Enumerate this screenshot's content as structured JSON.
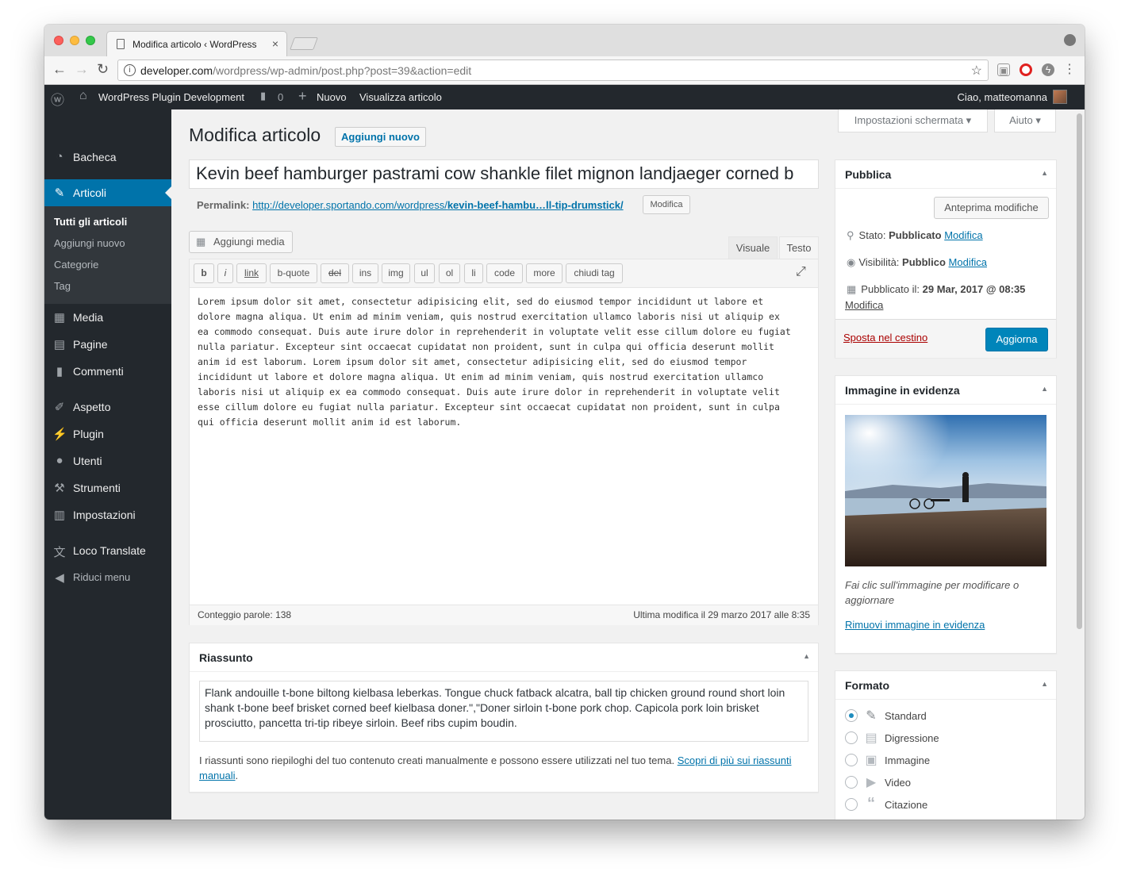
{
  "browser": {
    "tab_title": "Modifica articolo ‹ WordPress",
    "tab_close": "×",
    "url_host": "developer.com",
    "url_path": "/wordpress/wp-admin/post.php?post=39&action=edit"
  },
  "adminbar": {
    "site_name": "WordPress Plugin Development",
    "comments_count": "0",
    "new_label": "Nuovo",
    "view_post": "Visualizza articolo",
    "greeting": "Ciao, matteomanna"
  },
  "sidebar": {
    "items": [
      {
        "label": "Bacheca",
        "icon": "dashboard-icon"
      },
      {
        "label": "Articoli",
        "icon": "pin-icon"
      },
      {
        "label": "Media",
        "icon": "media-icon"
      },
      {
        "label": "Pagine",
        "icon": "page-icon"
      },
      {
        "label": "Commenti",
        "icon": "comment-icon"
      },
      {
        "label": "Aspetto",
        "icon": "brush-icon"
      },
      {
        "label": "Plugin",
        "icon": "plugin-icon"
      },
      {
        "label": "Utenti",
        "icon": "user-icon"
      },
      {
        "label": "Strumenti",
        "icon": "wrench-icon"
      },
      {
        "label": "Impostazioni",
        "icon": "settings-icon"
      },
      {
        "label": "Loco Translate",
        "icon": "translate-icon"
      },
      {
        "label": "Riduci menu",
        "icon": "collapse-icon"
      }
    ],
    "submenu": [
      "Tutti gli articoli",
      "Aggiungi nuovo",
      "Categorie",
      "Tag"
    ]
  },
  "header": {
    "title": "Modifica articolo",
    "add_new": "Aggiungi nuovo",
    "screen_options": "Impostazioni schermata",
    "help": "Aiuto"
  },
  "post": {
    "title": "Kevin beef hamburger pastrami cow shankle filet mignon landjaeger corned b",
    "permalink_label": "Permalink:",
    "permalink_base": "http://developer.sportando.com/wordpress/",
    "permalink_slug": "kevin-beef-hambu…ll-tip-drumstick/",
    "permalink_edit": "Modifica"
  },
  "editor": {
    "add_media": "Aggiungi media",
    "tab_visual": "Visuale",
    "tab_text": "Testo",
    "quicktags": [
      "b",
      "i",
      "link",
      "b-quote",
      "del",
      "ins",
      "img",
      "ul",
      "ol",
      "li",
      "code",
      "more",
      "chiudi tag"
    ],
    "content": "Lorem ipsum dolor sit amet, consectetur adipisicing elit, sed do eiusmod tempor incididunt ut labore et\ndolore magna aliqua. Ut enim ad minim veniam, quis nostrud exercitation ullamco laboris nisi ut aliquip ex\nea commodo consequat. Duis aute irure dolor in reprehenderit in voluptate velit esse cillum dolore eu fugiat\nnulla pariatur. Excepteur sint occaecat cupidatat non proident, sunt in culpa qui officia deserunt mollit\nanim id est laborum. Lorem ipsum dolor sit amet, consectetur adipisicing elit, sed do eiusmod tempor\nincididunt ut labore et dolore magna aliqua. Ut enim ad minim veniam, quis nostrud exercitation ullamco\nlaboris nisi ut aliquip ex ea commodo consequat. Duis aute irure dolor in reprehenderit in voluptate velit\nesse cillum dolore eu fugiat nulla pariatur. Excepteur sint occaecat cupidatat non proident, sunt in culpa\nqui officia deserunt mollit anim id est laborum.",
    "word_count": "Conteggio parole: 138",
    "last_edit": "Ultima modifica il 29 marzo 2017 alle 8:35"
  },
  "excerpt": {
    "title": "Riassunto",
    "text": "Flank andouille t-bone biltong kielbasa leberkas. Tongue chuck fatback alcatra, ball tip chicken ground round short loin shank t-bone beef brisket corned beef kielbasa doner.\",\"Doner sirloin t-bone pork chop. Capicola pork loin brisket prosciutto, pancetta tri-tip ribeye sirloin. Beef ribs cupim boudin.",
    "help": "I riassunti sono riepiloghi del tuo contenuto creati manualmente e possono essere utilizzati nel tuo tema.",
    "help_link": "Scopri di più sui riassunti manuali",
    "help_end": "."
  },
  "publish": {
    "title": "Pubblica",
    "preview": "Anteprima modifiche",
    "status_label": "Stato:",
    "status_value": "Pubblicato",
    "visibility_label": "Visibilità:",
    "visibility_value": "Pubblico",
    "date_label": "Pubblicato il:",
    "date_value": "29 Mar, 2017 @ 08:35",
    "edit": "Modifica",
    "trash": "Sposta nel cestino",
    "update": "Aggiorna"
  },
  "featured": {
    "title": "Immagine in evidenza",
    "hint": "Fai clic sull'immagine per modificare o aggiornare",
    "remove": "Rimuovi immagine in evidenza"
  },
  "format": {
    "title": "Formato",
    "options": [
      "Standard",
      "Digressione",
      "Immagine",
      "Video",
      "Citazione"
    ],
    "selected": "Standard"
  },
  "colors": {
    "accent": "#0073aa",
    "adminbar": "#23282d",
    "primary_button": "#0085ba",
    "trash": "#a00"
  }
}
